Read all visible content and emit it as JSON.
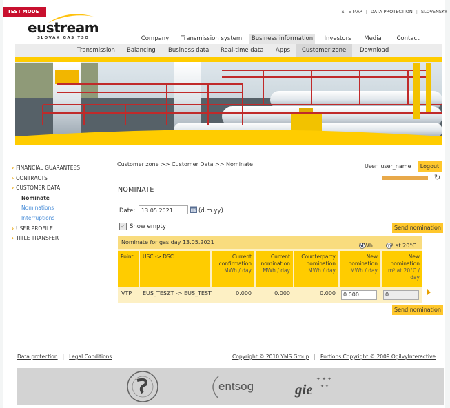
{
  "test_mode_label": "TEST MODE",
  "logo": {
    "name": "eustream",
    "tagline": "SLOVAK GAS TSO"
  },
  "top_links": [
    "SITE MAP",
    "DATA PROTECTION",
    "SLOVENSKY"
  ],
  "main_nav": [
    "Company",
    "Transmission system",
    "Business information",
    "Investors",
    "Media",
    "Contact"
  ],
  "sub_nav": [
    "Transmission",
    "Balancing",
    "Business data",
    "Real-time data",
    "Apps",
    "Customer zone",
    "Download"
  ],
  "left_nav": {
    "financial_guarantees": "FINANCIAL GUARANTEES",
    "contracts": "CONTRACTS",
    "customer_data": "CUSTOMER DATA",
    "nominate": "Nominate",
    "nominations": "Nominations",
    "interruptions": "Interruptions",
    "user_profile": "USER PROFILE",
    "title_transfer": "TITLE TRANSFER"
  },
  "breadcrumb": {
    "part1": "Customer zone",
    "sep1": " >> ",
    "part2": "Customer Data",
    "sep2": " >> ",
    "part3": "Nominate"
  },
  "user": {
    "label": "User:",
    "name": "user_name",
    "logout": "Logout"
  },
  "session_progress": 1.0,
  "page_title": "NOMINATE",
  "date": {
    "label": "Date:",
    "value": "13.05.2021",
    "format": "(d.m.yy)"
  },
  "show_empty": {
    "label": "Show empty",
    "checked": true
  },
  "send_nomination_label": "Send nomination",
  "table": {
    "title": "Nominate for gas day 13.05.2021",
    "unit_mwh": "MWh",
    "unit_m3": "m³ at 20°C",
    "headers": {
      "point": "Point",
      "usc": "USC -> DSC",
      "cur_conf": "Current confirmation",
      "cur_conf_unit": "MWh / day",
      "cur_nom": "Current nomination",
      "cur_nom_unit": "MWh / day",
      "cp_nom": "Counterparty nomination",
      "cp_nom_unit": "MWh / day",
      "new_nom_mwh": "New nomination",
      "new_nom_mwh_unit": "MWh / day",
      "new_nom_m3": "New nomination",
      "new_nom_m3_unit": "m³ at 20°C / day"
    },
    "row": {
      "point": "VTP",
      "usc": "EUS_TESZT -> EUS_TEST",
      "cur_conf": "0.000",
      "cur_nom": "0.000",
      "cp_nom": "0.000",
      "new_mwh": "0.000",
      "new_m3": "0"
    }
  },
  "footer": {
    "data_protection": "Data protection",
    "legal": "Legal Conditions",
    "copyright": "Copyright © 2010 YMS Group",
    "portions": "Portions Copyright © 2009 OgilvyInteractive"
  },
  "partner_logos": {
    "entsog": "entsog",
    "gie": "gie"
  }
}
